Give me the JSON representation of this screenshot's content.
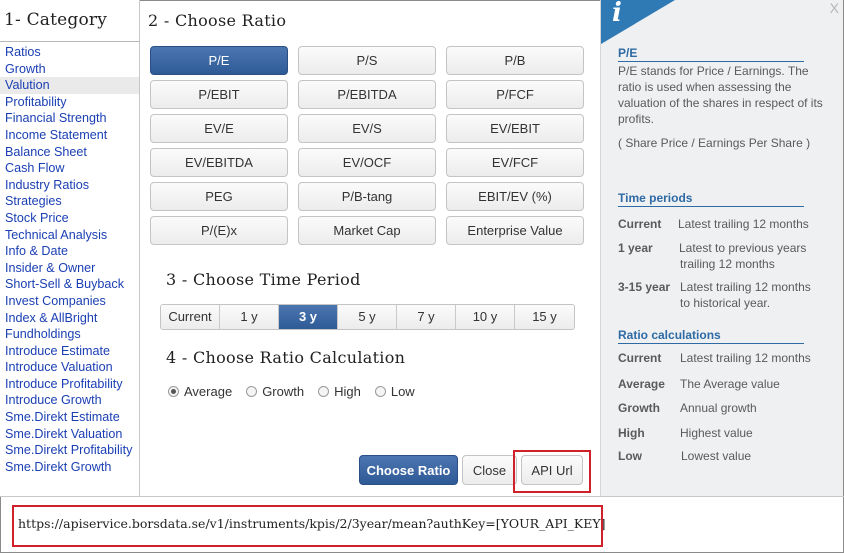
{
  "category": {
    "title": "1- Category",
    "items": [
      "Ratios",
      "Growth",
      "Valution",
      "Profitability",
      "Financial Strength",
      "Income Statement",
      "Balance Sheet",
      "Cash Flow",
      "Industry Ratios",
      "Strategies",
      "Stock Price",
      "Technical Analysis",
      "Info & Date",
      "Insider & Owner",
      "Short-Sell & Buyback",
      "Invest Companies",
      "Index & AllBright",
      "Fundholdings",
      "Introduce Estimate",
      "Introduce Valuation",
      "Introduce Profitability",
      "Introduce Growth",
      "Sme.Direkt Estimate",
      "Sme.Direkt Valuation",
      "Sme.Direkt Profitability",
      "Sme.Direkt Growth"
    ],
    "active": "Valution"
  },
  "ratio": {
    "title": "2 - Choose Ratio",
    "buttons": [
      "P/E",
      "P/S",
      "P/B",
      "P/EBIT",
      "P/EBITDA",
      "P/FCF",
      "EV/E",
      "EV/S",
      "EV/EBIT",
      "EV/EBITDA",
      "EV/OCF",
      "EV/FCF",
      "PEG",
      "P/B-tang",
      "EBIT/EV (%)",
      "P/(E)x",
      "Market Cap",
      "Enterprise Value"
    ],
    "active": "P/E"
  },
  "period": {
    "title": "3 - Choose Time Period",
    "options": [
      "Current",
      "1 y",
      "3 y",
      "5 y",
      "7 y",
      "10 y",
      "15 y"
    ],
    "active": "3 y"
  },
  "calc": {
    "title": "4 - Choose Ratio Calculation",
    "options": [
      "Average",
      "Growth",
      "High",
      "Low"
    ],
    "selected": "Average"
  },
  "actions": {
    "choose_label": "Choose Ratio",
    "close_label": "Close",
    "api_label": "API Url"
  },
  "info": {
    "icon": "info-icon",
    "close_glyph": "X",
    "heading": "P/E",
    "description": "P/E stands for Price / Earnings. The ratio is used when assessing the valuation of the shares in respect of its profits.",
    "formula": "( Share Price / Earnings Per Share )",
    "time_periods": {
      "heading": "Time periods",
      "rows": [
        {
          "key": "Current",
          "value": "Latest trailing 12 months"
        },
        {
          "key": "1 year",
          "value": "Latest to previous years",
          "value2": "trailing 12 months"
        },
        {
          "key": "3-15 year",
          "value": "Latest trailing  12 months",
          "value2": "to historical year."
        }
      ]
    },
    "ratio_calc": {
      "heading": "Ratio calculations",
      "rows": [
        {
          "key": "Current",
          "value": "Latest trailing 12 months"
        },
        {
          "key": "Average",
          "value": "The Average value"
        },
        {
          "key": "Growth",
          "value": "Annual growth"
        },
        {
          "key": "High",
          "value": "Highest value"
        },
        {
          "key": "Low",
          "value": "Lowest value"
        }
      ]
    }
  },
  "api_url": "https://apiservice.borsdata.se/v1/instruments/kpis/2/3year/mean?authKey=[YOUR_API_KEY]",
  "colors": {
    "accent": "#2e5a96",
    "link": "#1a3fb3",
    "highlight": "#d0202a",
    "info_blue": "#2f79b5"
  }
}
